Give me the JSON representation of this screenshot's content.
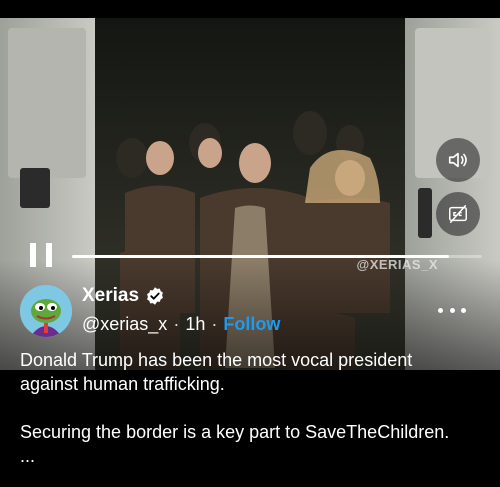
{
  "post": {
    "display_name": "Xerias",
    "handle": "@xerias_x",
    "separator": "·",
    "time_ago": "1h",
    "follow_label": "Follow",
    "verified": true,
    "more_icon": "more-horizontal-icon",
    "text_line_1": "Donald Trump has been the most vocal president",
    "text_line_2": "against human trafficking.",
    "text_line_3": "Securing the border is a key part to SaveTheChildren.",
    "truncation": "..."
  },
  "video": {
    "watermark": "@XERIAS_X",
    "progress_fraction": 0.92,
    "state": "playing",
    "controls": {
      "pause_icon": "pause-icon",
      "volume_icon": "volume-icon",
      "captions_icon": "captions-off-icon"
    }
  },
  "colors": {
    "background": "#000000",
    "link_blue": "#1d9bf0",
    "text": "#ffffff"
  }
}
